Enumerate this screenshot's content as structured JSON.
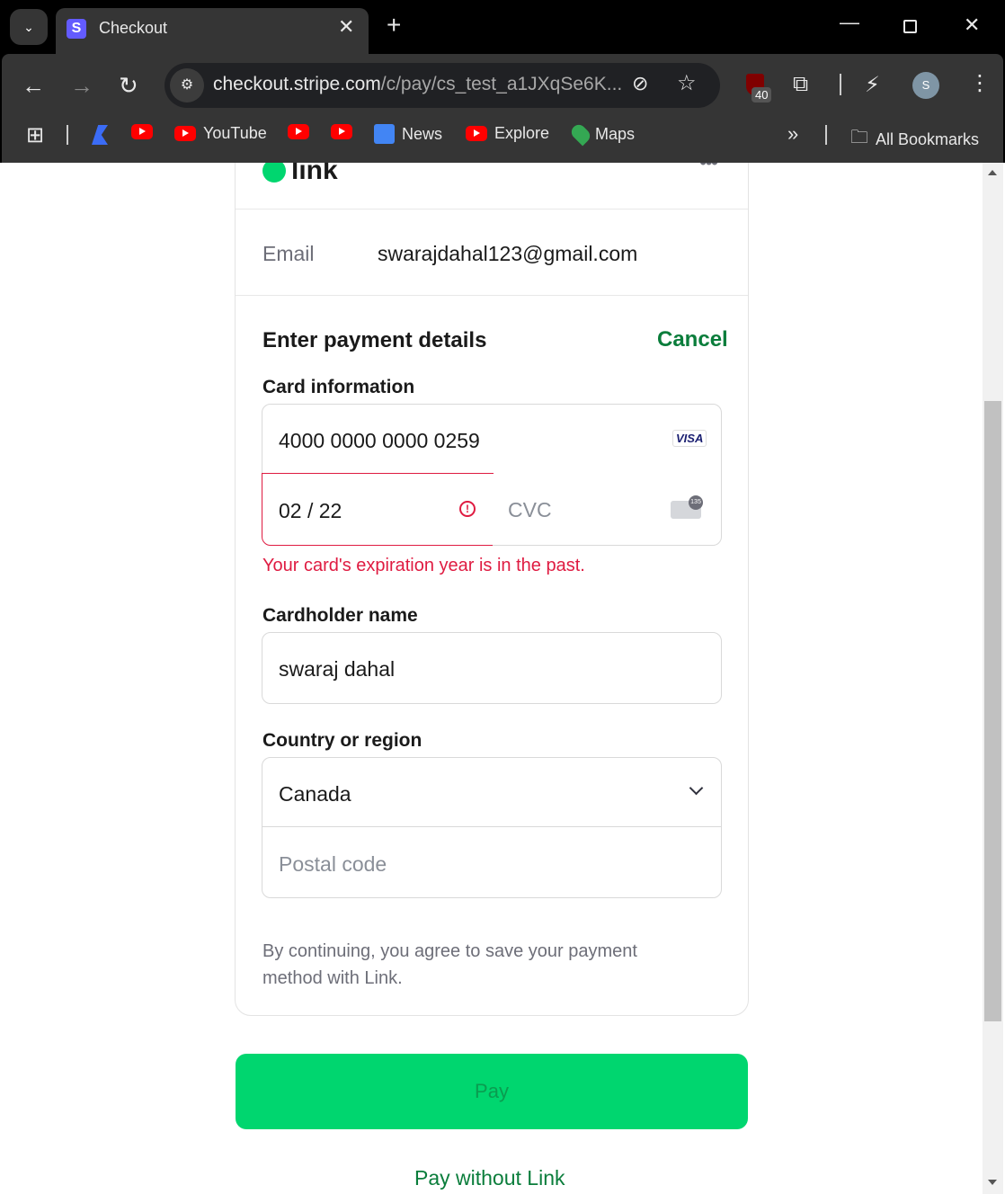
{
  "browser": {
    "tab_title": "Checkout",
    "url_host": "checkout.stripe.com",
    "url_path": "/c/pay/cs_test_a1JXqSe6K...",
    "ext_badge": "40",
    "profile_initial": "S",
    "bookmarks": [
      "YouTube",
      "News",
      "Explore",
      "Maps"
    ],
    "all_bookmarks": "All Bookmarks"
  },
  "link": {
    "logo": "link",
    "email_label": "Email",
    "email": "swarajdahal123@gmail.com"
  },
  "payment": {
    "heading": "Enter payment details",
    "cancel": "Cancel",
    "card_label": "Card information",
    "card_number": "4000 0000 0000 0259",
    "card_brand": "VISA",
    "expiry": "02 / 22",
    "cvc_placeholder": "CVC",
    "cvc_icon_text": "135",
    "error": "Your card's expiration year is in the past.",
    "name_label": "Cardholder name",
    "name": "swaraj dahal",
    "country_label": "Country or region",
    "country": "Canada",
    "postal_placeholder": "Postal code",
    "consent": "By continuing, you agree to save your payment method with Link."
  },
  "actions": {
    "pay": "Pay",
    "pay_without_link": "Pay without Link"
  },
  "colors": {
    "green": "#00d66f",
    "link_text": "#0a7d3b",
    "error": "#df1b41"
  }
}
